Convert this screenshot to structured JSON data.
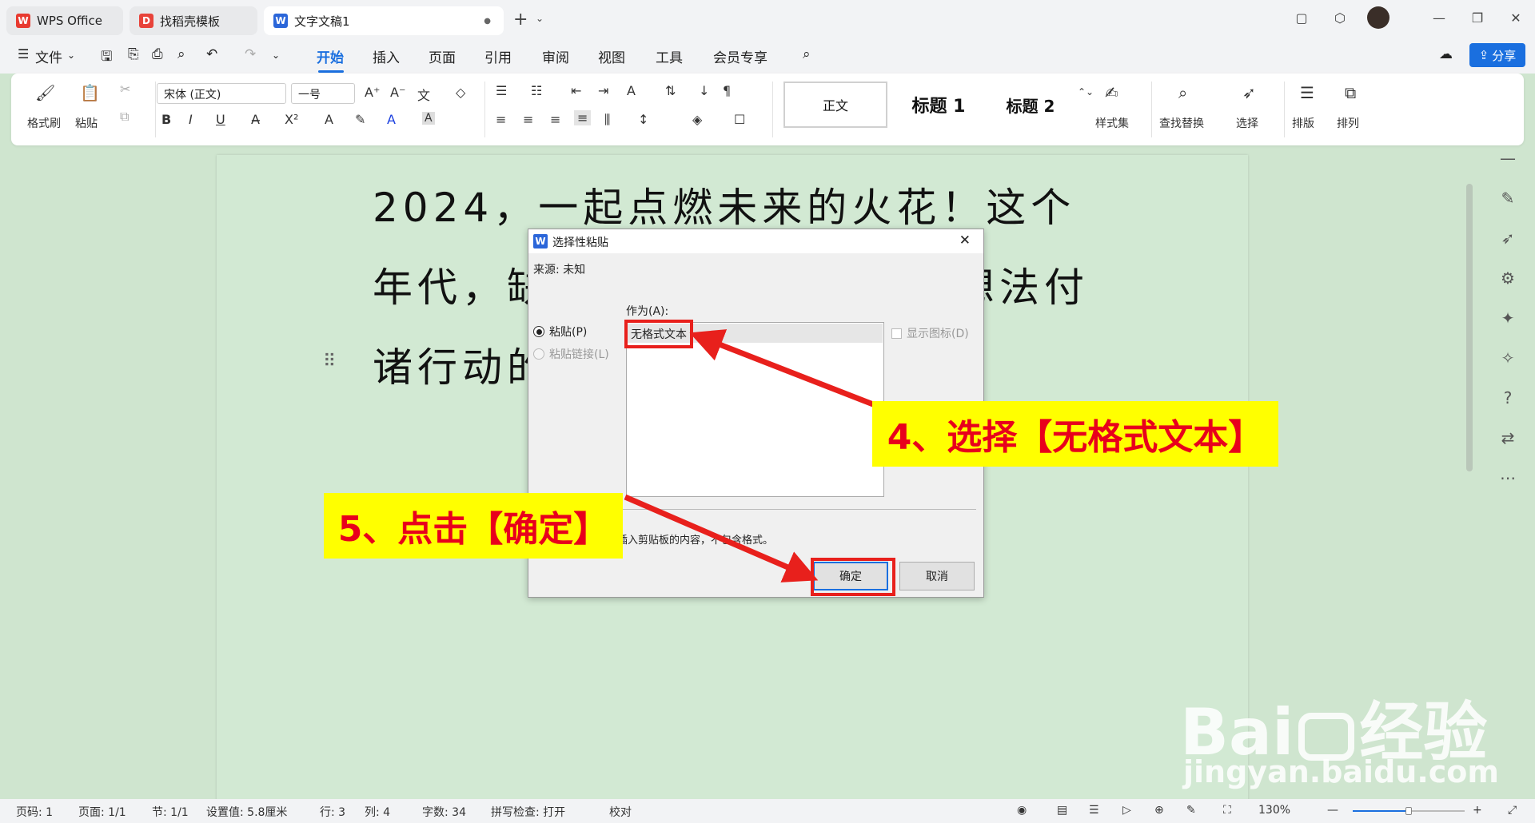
{
  "tabs": [
    {
      "label": "WPS Office"
    },
    {
      "label": "找稻壳模板"
    },
    {
      "label": "文字文稿1"
    }
  ],
  "tab_close": "●",
  "menu": {
    "file": "文件",
    "items": [
      "开始",
      "插入",
      "页面",
      "引用",
      "审阅",
      "视图",
      "工具",
      "会员专享"
    ],
    "share": "分享"
  },
  "ribbon": {
    "format_painter": "格式刷",
    "paste": "粘贴",
    "font_name": "宋体 (正文)",
    "font_size": "一号",
    "styles": [
      "正文",
      "标题 1",
      "标题 2"
    ],
    "style_set": "样式集",
    "find_replace": "查找替换",
    "select": "选择",
    "layout": "排版",
    "arrange": "排列"
  },
  "document": {
    "text": "2024，一起点燃未来的火花！这个年代，缺的不是机会，而是把想法付诸行动的勇气！"
  },
  "dialog": {
    "title": "选择性粘贴",
    "source": "来源: 未知",
    "as_label": "作为(A):",
    "option_paste": "粘贴(P)",
    "option_paste_link": "粘贴链接(L)",
    "list_items": [
      "无格式文本"
    ],
    "show_icon": "显示图标(D)",
    "result_text": "式插入剪贴板的内容，不包含格式。",
    "ok": "确定",
    "cancel": "取消"
  },
  "annotations": {
    "step4": "4、选择【无格式文本】",
    "step5": "5、点击【确定】"
  },
  "status": {
    "page_code": "页码: 1",
    "pages": "页面: 1/1",
    "section": "节: 1/1",
    "setting": "设置值: 5.8厘米",
    "row": "行: 3",
    "col": "列: 4",
    "words": "字数: 34",
    "spell": "拼写检查: 打开",
    "proof": "校对",
    "zoom": "130%"
  },
  "watermark": {
    "brand": "Bai",
    "brand2": "经验",
    "url": "jingyan.baidu.com"
  },
  "colors": {
    "accent": "#1a6fdf",
    "annotation_bg": "#ffff00",
    "annotation_text": "#e8001c",
    "page_bg": "#d2e9d3"
  }
}
